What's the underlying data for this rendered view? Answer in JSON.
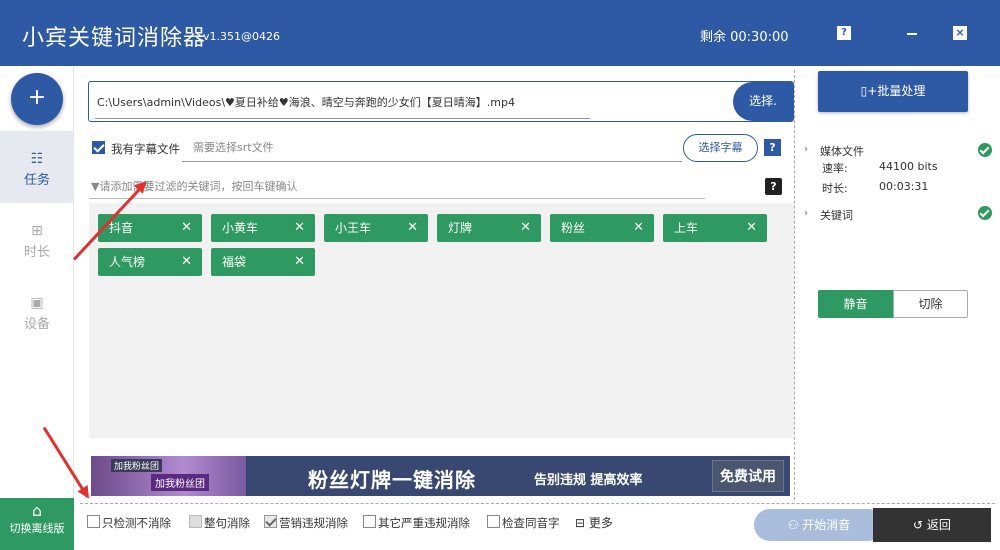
{
  "titlebar": {
    "app_title": "小宾关键词消除器",
    "version": "v1.351@0426",
    "remaining": "剩余 00:30:00",
    "help_label": "?",
    "close_label": "×"
  },
  "sidebar": {
    "add_label": "+",
    "items": [
      {
        "label": "任务",
        "icon": "task-icon",
        "active": true
      },
      {
        "label": "时长",
        "icon": "duration-icon",
        "active": false
      },
      {
        "label": "设备",
        "icon": "device-icon",
        "active": false
      }
    ],
    "offline_label": "切换离线版"
  },
  "file": {
    "path": "C:\\Users\\admin\\Videos\\♥夏日补给♥海浪、晴空与奔跑的少女们【夏日晴海】.mp4",
    "select_label": "选择."
  },
  "subtitle": {
    "checkbox_label": "我有字幕文件",
    "checked": true,
    "placeholder": "需要选择srt文件",
    "choose_label": "选择字幕",
    "help_label": "?"
  },
  "filter": {
    "placeholder": "请添加需要过滤的关键词，按回车键确认",
    "help_label": "?"
  },
  "keywords": [
    "抖音",
    "小黄车",
    "小王车",
    "灯牌",
    "粉丝",
    "上车",
    "人气榜",
    "福袋"
  ],
  "keyword_remove_label": "✕",
  "banner": {
    "badge1": "加我粉丝团",
    "badge2": "加我粉丝团",
    "title": "粉丝灯牌一键消除",
    "subtitle": "告别违规 提高效率",
    "button": "免费试用"
  },
  "right_panel": {
    "batch_label": "批量处理",
    "media_label": "媒体文件",
    "rate_label": "速率:",
    "rate_value": "44100 bits",
    "duration_label": "时长:",
    "duration_value": "00:03:31",
    "keyword_label": "关键词",
    "mute_label": "静音",
    "cut_label": "切除"
  },
  "options": [
    {
      "label": "只检测不消除",
      "state": "unchecked"
    },
    {
      "label": "整句消除",
      "state": "disabled"
    },
    {
      "label": "营销违规消除",
      "state": "checked-gray"
    },
    {
      "label": "其它严重违规消除",
      "state": "unchecked"
    },
    {
      "label": "检查同音字",
      "state": "unchecked"
    }
  ],
  "more_label": "更多",
  "start_label": "开始消音",
  "back_label": "返回",
  "colors": {
    "primary": "#2e5aa5",
    "green": "#2e9960",
    "arrow": "#e03030"
  }
}
